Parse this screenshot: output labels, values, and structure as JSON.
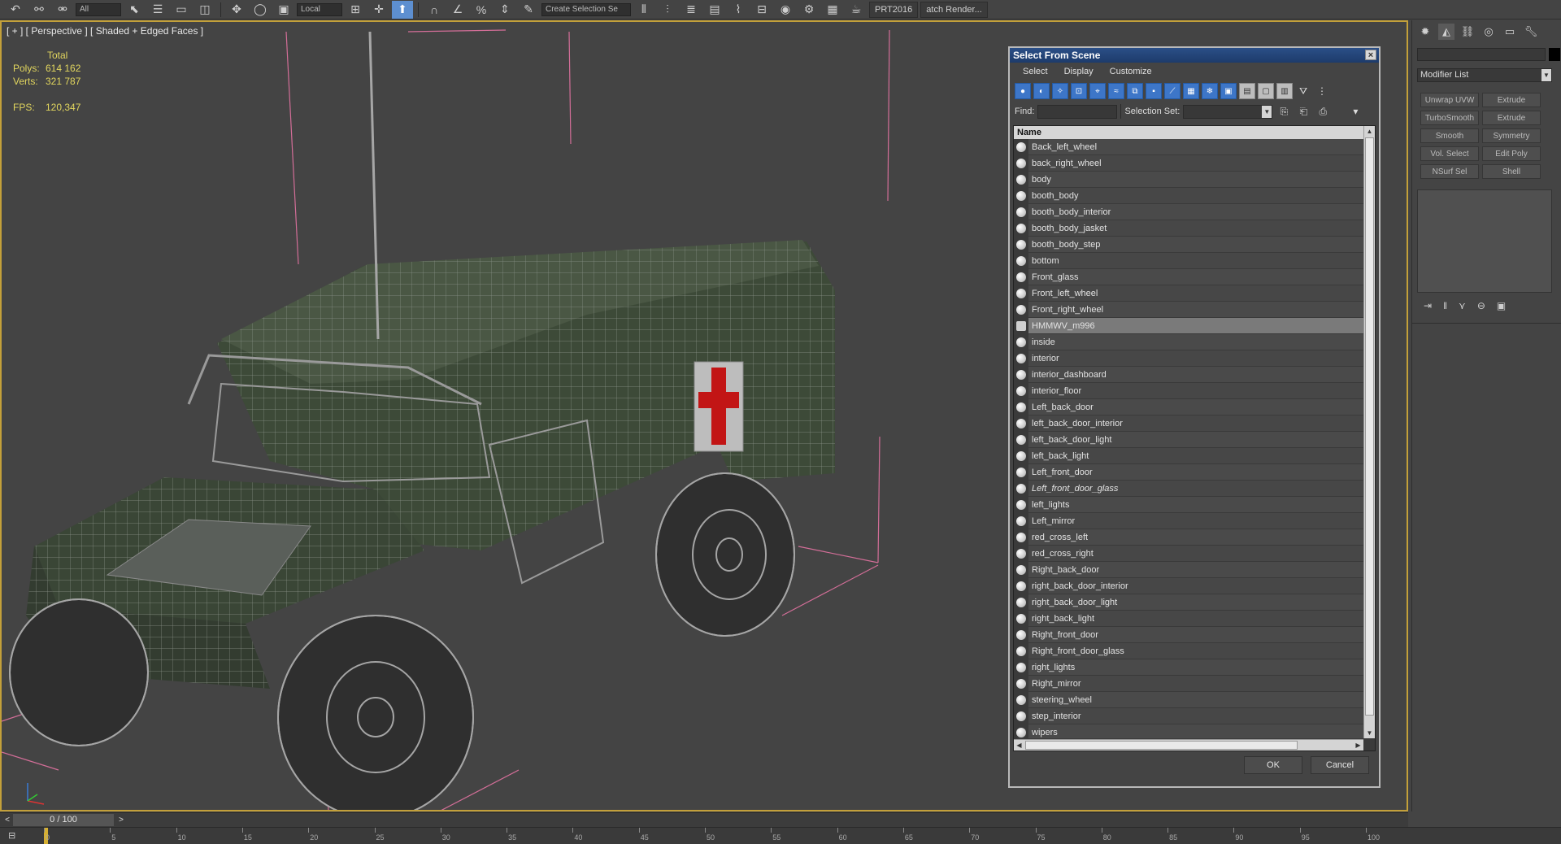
{
  "toolbar": {
    "combo_small": "All",
    "combo_ref": "Local",
    "combo_selset": "Create Selection Se",
    "label_prt": "PRT2016",
    "label_batch": "atch Render..."
  },
  "viewport": {
    "label": "[ + ] [ Perspective ] [ Shaded + Edged Faces ]",
    "stats": {
      "header": "Total",
      "polys_label": "Polys:",
      "polys_value": "614 162",
      "verts_label": "Verts:",
      "verts_value": "321 787",
      "fps_label": "FPS:",
      "fps_value": "120,347"
    }
  },
  "dialog": {
    "title": "Select From Scene",
    "close": "×",
    "menu": [
      "Select",
      "Display",
      "Customize"
    ],
    "find_label": "Find:",
    "selset_label": "Selection Set:",
    "column_header": "Name",
    "items": [
      {
        "name": "Back_left_wheel",
        "selected": false,
        "italic": false,
        "group": false
      },
      {
        "name": "back_right_wheel",
        "selected": false,
        "italic": false,
        "group": false
      },
      {
        "name": "body",
        "selected": false,
        "italic": false,
        "group": false
      },
      {
        "name": "booth_body",
        "selected": false,
        "italic": false,
        "group": false
      },
      {
        "name": "booth_body_interior",
        "selected": false,
        "italic": false,
        "group": false
      },
      {
        "name": "booth_body_jasket",
        "selected": false,
        "italic": false,
        "group": false
      },
      {
        "name": "booth_body_step",
        "selected": false,
        "italic": false,
        "group": false
      },
      {
        "name": "bottom",
        "selected": false,
        "italic": false,
        "group": false
      },
      {
        "name": "Front_glass",
        "selected": false,
        "italic": false,
        "group": false
      },
      {
        "name": "Front_left_wheel",
        "selected": false,
        "italic": false,
        "group": false
      },
      {
        "name": "Front_right_wheel",
        "selected": false,
        "italic": false,
        "group": false
      },
      {
        "name": "HMMWV_m996",
        "selected": true,
        "italic": false,
        "group": true
      },
      {
        "name": "inside",
        "selected": false,
        "italic": false,
        "group": false
      },
      {
        "name": "interior",
        "selected": false,
        "italic": false,
        "group": false
      },
      {
        "name": "interior_dashboard",
        "selected": false,
        "italic": false,
        "group": false
      },
      {
        "name": "interior_floor",
        "selected": false,
        "italic": false,
        "group": false
      },
      {
        "name": "Left_back_door",
        "selected": false,
        "italic": false,
        "group": false
      },
      {
        "name": "left_back_door_interior",
        "selected": false,
        "italic": false,
        "group": false
      },
      {
        "name": "left_back_door_light",
        "selected": false,
        "italic": false,
        "group": false
      },
      {
        "name": "left_back_light",
        "selected": false,
        "italic": false,
        "group": false
      },
      {
        "name": "Left_front_door",
        "selected": false,
        "italic": false,
        "group": false
      },
      {
        "name": "Left_front_door_glass",
        "selected": false,
        "italic": true,
        "group": false
      },
      {
        "name": "left_lights",
        "selected": false,
        "italic": false,
        "group": false
      },
      {
        "name": "Left_mirror",
        "selected": false,
        "italic": false,
        "group": false
      },
      {
        "name": "red_cross_left",
        "selected": false,
        "italic": false,
        "group": false
      },
      {
        "name": "red_cross_right",
        "selected": false,
        "italic": false,
        "group": false
      },
      {
        "name": "Right_back_door",
        "selected": false,
        "italic": false,
        "group": false
      },
      {
        "name": "right_back_door_interior",
        "selected": false,
        "italic": false,
        "group": false
      },
      {
        "name": "right_back_door_light",
        "selected": false,
        "italic": false,
        "group": false
      },
      {
        "name": "right_back_light",
        "selected": false,
        "italic": false,
        "group": false
      },
      {
        "name": "Right_front_door",
        "selected": false,
        "italic": false,
        "group": false
      },
      {
        "name": "Right_front_door_glass",
        "selected": false,
        "italic": false,
        "group": false
      },
      {
        "name": "right_lights",
        "selected": false,
        "italic": false,
        "group": false
      },
      {
        "name": "Right_mirror",
        "selected": false,
        "italic": false,
        "group": false
      },
      {
        "name": "steering_wheel",
        "selected": false,
        "italic": false,
        "group": false
      },
      {
        "name": "step_interior",
        "selected": false,
        "italic": false,
        "group": false
      },
      {
        "name": "wipers",
        "selected": false,
        "italic": false,
        "group": false
      }
    ],
    "ok_label": "OK",
    "cancel_label": "Cancel"
  },
  "command_panel": {
    "modifier_list": "Modifier List",
    "buttons": [
      "Unwrap UVW",
      "Extrude",
      "TurboSmooth",
      "Extrude",
      "Smooth",
      "Symmetry",
      "Vol. Select",
      "Edit Poly",
      "NSurf Sel",
      "Shell"
    ]
  },
  "timeline": {
    "frame": "0 / 100",
    "prev": "<",
    "next": ">",
    "ticks": [
      "0",
      "5",
      "10",
      "15",
      "20",
      "25",
      "30",
      "35",
      "40",
      "45",
      "50",
      "55",
      "60",
      "65",
      "70",
      "75",
      "80",
      "85",
      "90",
      "95",
      "100"
    ]
  },
  "colors": {
    "viewport_border": "#c3a03a",
    "stats_text": "#e2d65e",
    "title_bar": "#1d3b6b",
    "selection": "#7a7a7a",
    "box_lines": "#d36e98",
    "vehicle_green": "#3d4a38",
    "cross_red": "#c21515"
  }
}
